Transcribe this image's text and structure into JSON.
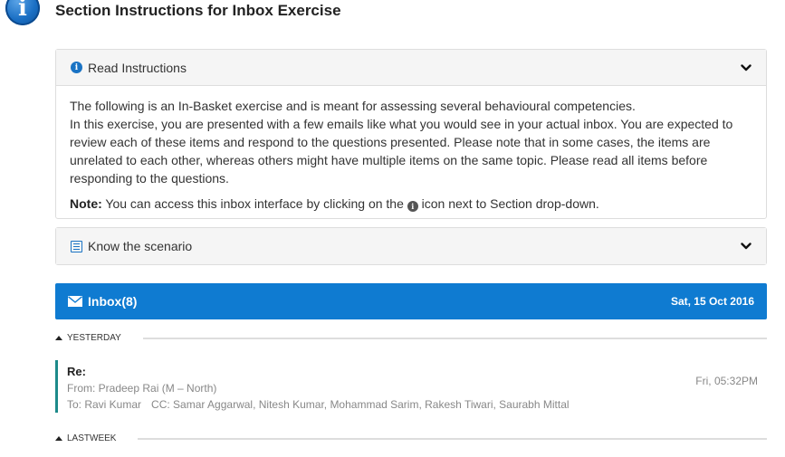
{
  "header": {
    "icon": "info-icon",
    "title": "Section Instructions for Inbox Exercise"
  },
  "read_panel": {
    "icon": "info-icon",
    "label": "Read Instructions",
    "toggle_icon": "chevron-down-icon",
    "body_line1": "The following is an In-Basket exercise and is meant for assessing several behavioural competencies.",
    "body_line2": "In this exercise, you are presented with a few emails like what you would see in your actual inbox. You are expected to review each of these items and respond to the questions presented. Please note that in some cases, the items are unrelated to each other, whereas others might have multiple items on the same topic. Please read all items before responding to the questions.",
    "note_label": "Note:",
    "note_pre": "You can access this inbox interface by clicking on the",
    "note_post": "icon next to Section drop-down."
  },
  "scenario_panel": {
    "icon": "list-icon",
    "label": "Know the scenario",
    "toggle_icon": "chevron-down-icon"
  },
  "inbox": {
    "icon": "envelope-icon",
    "title": "Inbox(8)",
    "date": "Sat, 15 Oct 2016",
    "bar_color": "#0f7bd1"
  },
  "groups": [
    {
      "label": "YESTERDAY",
      "emails": [
        {
          "subject": "Re:",
          "from": "From: Pradeep Rai (M – North)",
          "to": "To: Ravi Kumar",
          "cc": "CC: Samar Aggarwal, Nitesh Kumar, Mohammad Sarim, Rakesh Tiwari, Saurabh Mittal",
          "time": "Fri, 05:32PM"
        }
      ]
    },
    {
      "label": "LASTWEEK",
      "emails": []
    }
  ]
}
